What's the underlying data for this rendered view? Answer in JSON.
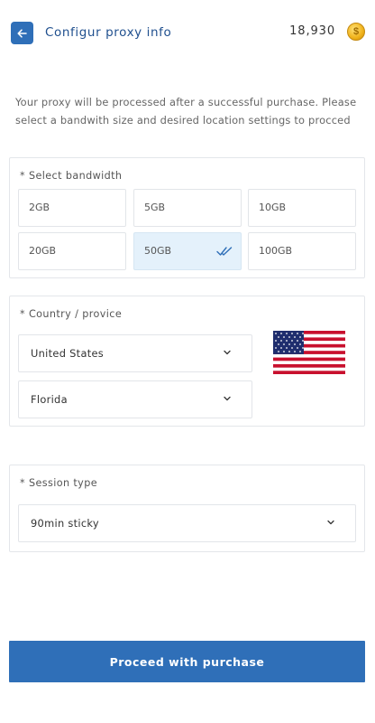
{
  "header": {
    "back_icon": "arrow-left-icon",
    "title": "Configur proxy info",
    "balance": "18,930",
    "coin_icon": "coin-icon",
    "coin_symbol": "$"
  },
  "intro": "Your proxy will be processed after a successful purchase. Please select a bandwith size and desired location settings to procced",
  "bandwidth": {
    "label": "* Select bandwidth",
    "options": [
      "2GB",
      "5GB",
      "10GB",
      "20GB",
      "50GB",
      "100GB"
    ],
    "selected": "50GB",
    "selected_icon": "double-check-icon"
  },
  "location": {
    "label": "* Country / provice",
    "country": "United States",
    "region": "Florida",
    "flag_icon": "us-flag-icon"
  },
  "session": {
    "label": "* Session type",
    "value": "90min sticky"
  },
  "cta": {
    "label": "Proceed with purchase"
  },
  "colors": {
    "primary": "#2f6fb8",
    "title": "#1f4f8e",
    "selected_bg": "#e4f1fb",
    "border": "#e3e6ea"
  }
}
